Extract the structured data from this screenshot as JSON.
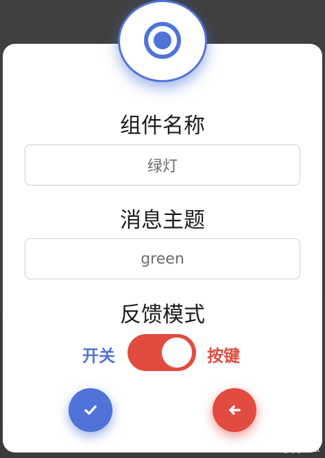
{
  "dialog": {
    "fields": [
      {
        "label": "组件名称",
        "value": "绿灯"
      },
      {
        "label": "消息主题",
        "value": "green"
      }
    ],
    "mode_label": "反馈模式",
    "toggle": {
      "left_label": "开关",
      "right_label": "按键",
      "state": "right"
    }
  },
  "buttons": {
    "confirm_icon": "check-icon",
    "back_icon": "arrow-left-icon"
  },
  "watermark": "CSDN @qdprobot",
  "colors": {
    "accent_blue": "#4f73d9",
    "accent_red": "#e24b3f"
  }
}
